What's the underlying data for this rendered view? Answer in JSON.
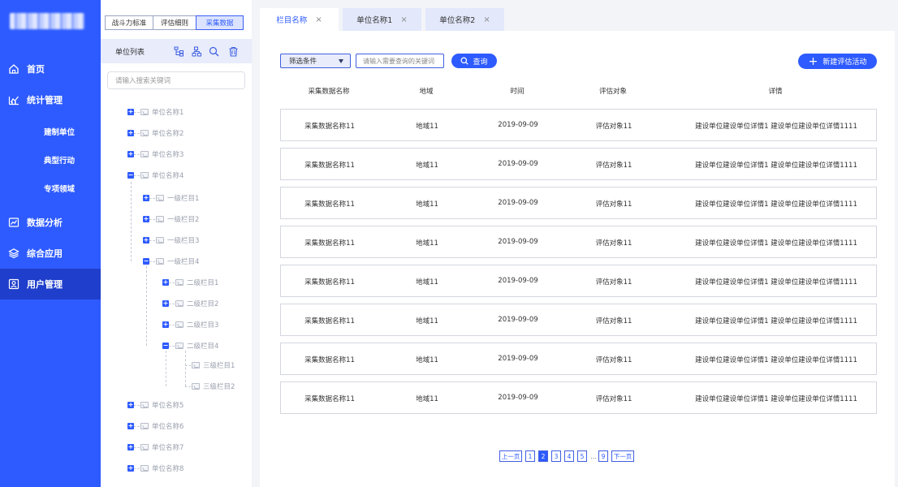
{
  "nav": {
    "items": [
      {
        "label": "首页",
        "icon": "home-icon"
      },
      {
        "label": "统计管理",
        "icon": "stats-icon"
      },
      {
        "label": "数据分析",
        "icon": "analysis-icon"
      },
      {
        "label": "综合应用",
        "icon": "layers-icon"
      },
      {
        "label": "用户管理",
        "icon": "user-icon"
      }
    ],
    "sub_items": [
      "建制单位",
      "典型行动",
      "专项领域"
    ]
  },
  "tree_panel": {
    "tabs": [
      "战斗力标准",
      "评估细则",
      "采集数据"
    ],
    "header_title": "单位列表",
    "search_placeholder": "请输入搜索关键词",
    "tree": [
      {
        "label": "单位名称1",
        "sign": "+"
      },
      {
        "label": "单位名称2",
        "sign": "+"
      },
      {
        "label": "单位名称3",
        "sign": "+"
      },
      {
        "label": "单位名称4",
        "sign": "−"
      },
      {
        "label": "一级栏目1",
        "sign": "+"
      },
      {
        "label": "一级栏目2",
        "sign": "+"
      },
      {
        "label": "一级栏目3",
        "sign": "+"
      },
      {
        "label": "一级栏目4",
        "sign": "−"
      },
      {
        "label": "二级栏目1",
        "sign": "+"
      },
      {
        "label": "二级栏目2",
        "sign": "+"
      },
      {
        "label": "二级栏目3",
        "sign": "+"
      },
      {
        "label": "二级栏目4",
        "sign": "−"
      },
      {
        "label": "三级栏目1",
        "sign": ""
      },
      {
        "label": "三级栏目2",
        "sign": ""
      },
      {
        "label": "单位名称5",
        "sign": "+"
      },
      {
        "label": "单位名称6",
        "sign": "+"
      },
      {
        "label": "单位名称7",
        "sign": "+"
      },
      {
        "label": "单位名称8",
        "sign": "+"
      }
    ]
  },
  "main": {
    "tabs": [
      {
        "label": "栏目名称",
        "close": "×"
      },
      {
        "label": "单位名称1",
        "close": "×"
      },
      {
        "label": "单位名称2",
        "close": "×"
      }
    ],
    "filter_label": "筛选条件",
    "keyword_placeholder": "请输入需要查询的关键词",
    "query_label": "查询",
    "new_label": "新建评估活动",
    "new_plus": "+",
    "table": {
      "headers": [
        "采集数据名称",
        "地域",
        "时间",
        "评估对象",
        "详情"
      ],
      "rows": [
        [
          "采集数据名称11",
          "地域11",
          "2019-09-09",
          "评估对象11",
          "建设单位建设单位详情1 建设单位建设单位详情1111"
        ],
        [
          "采集数据名称11",
          "地域11",
          "2019-09-09",
          "评估对象11",
          "建设单位建设单位详情1 建设单位建设单位详情1111"
        ],
        [
          "采集数据名称11",
          "地域11",
          "2019-09-09",
          "评估对象11",
          "建设单位建设单位详情1 建设单位建设单位详情1111"
        ],
        [
          "采集数据名称11",
          "地域11",
          "2019-09-09",
          "评估对象11",
          "建设单位建设单位详情1 建设单位建设单位详情1111"
        ],
        [
          "采集数据名称11",
          "地域11",
          "2019-09-09",
          "评估对象11",
          "建设单位建设单位详情1 建设单位建设单位详情1111"
        ],
        [
          "采集数据名称11",
          "地域11",
          "2019-09-09",
          "评估对象11",
          "建设单位建设单位详情1 建设单位建设单位详情1111"
        ],
        [
          "采集数据名称11",
          "地域11",
          "2019-09-09",
          "评估对象11",
          "建设单位建设单位详情1 建设单位建设单位详情1111"
        ],
        [
          "采集数据名称11",
          "地域11",
          "2019-09-09",
          "评估对象11",
          "建设单位建设单位详情1 建设单位建设单位详情1111"
        ]
      ]
    },
    "pagination": {
      "prev": "上一页",
      "pages": [
        "1",
        "2",
        "3",
        "4",
        "5"
      ],
      "current": "2",
      "dots": "...",
      "last": "9",
      "next": "下一页"
    }
  },
  "colors": {
    "primary": "#2e5bff",
    "nav_active": "#1f3ecb",
    "tab_inactive": "#e3e8fb",
    "page_bg": "#f3f4f8"
  }
}
